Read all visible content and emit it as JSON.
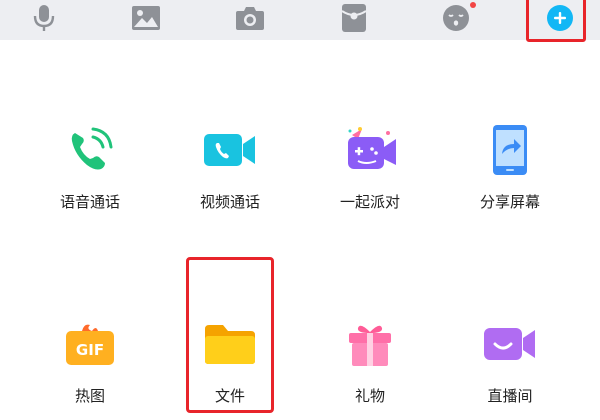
{
  "toolbar": {
    "icons": [
      "mic-icon",
      "image-icon",
      "camera-icon",
      "red-packet-icon",
      "emoji-icon",
      "plus-icon"
    ],
    "accent": "#12b7f5",
    "highlight_color": "#e8242a"
  },
  "panel": {
    "row1": [
      {
        "label": "语音通话",
        "icon": "voice-call-icon"
      },
      {
        "label": "视频通话",
        "icon": "video-call-icon"
      },
      {
        "label": "一起派对",
        "icon": "party-icon"
      },
      {
        "label": "分享屏幕",
        "icon": "share-screen-icon"
      }
    ],
    "row2": [
      {
        "label": "热图",
        "icon": "gif-icon"
      },
      {
        "label": "文件",
        "icon": "folder-icon"
      },
      {
        "label": "礼物",
        "icon": "gift-icon"
      },
      {
        "label": "直播间",
        "icon": "live-room-icon"
      }
    ]
  }
}
